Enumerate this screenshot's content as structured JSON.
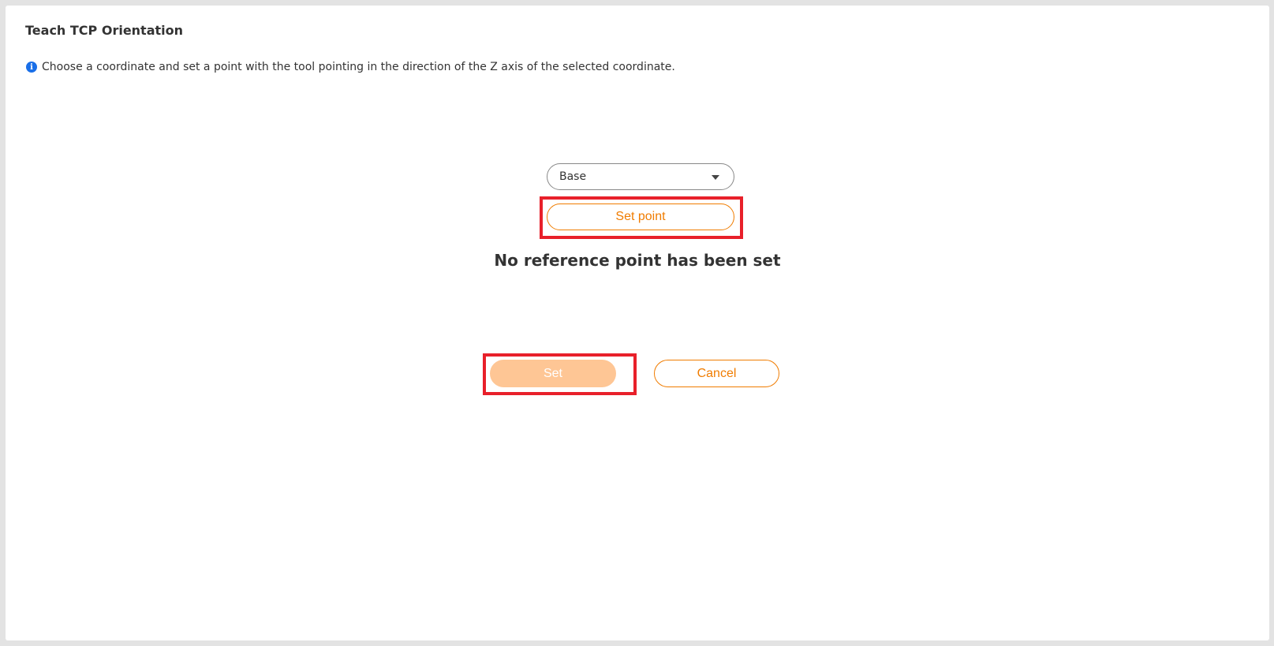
{
  "dialog": {
    "title": "Teach TCP Orientation",
    "info_icon": "info-icon",
    "info_text": "Choose a coordinate and set a point with the tool pointing in the direction of the Z axis of the selected coordinate."
  },
  "coordinate_select": {
    "selected": "Base",
    "caret_icon": "chevron-down-icon"
  },
  "set_point_button": {
    "label": "Set point"
  },
  "status_text": "No reference point has been set",
  "actions": {
    "set_label": "Set",
    "set_disabled": true,
    "cancel_label": "Cancel"
  },
  "colors": {
    "accent": "#f07c00",
    "accent_disabled": "#fec695",
    "highlight": "#e8202a",
    "info": "#1a6fe8"
  }
}
